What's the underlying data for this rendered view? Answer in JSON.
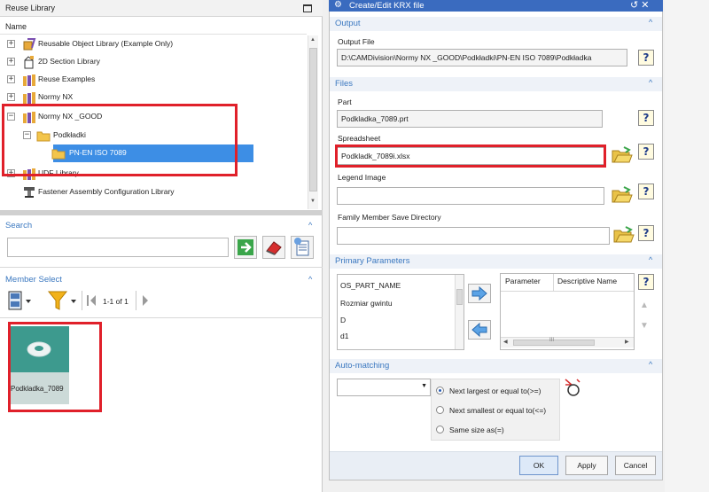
{
  "reuse_library": {
    "title": "Reuse Library",
    "column_header": "Name",
    "tree": [
      {
        "label": "Reusable Object Library (Example Only)",
        "icon": "library-cube-icon"
      },
      {
        "label": "2D Section Library",
        "icon": "section-library-icon"
      },
      {
        "label": "Reuse Examples",
        "icon": "books-icon"
      },
      {
        "label": "Normy NX",
        "icon": "books-icon"
      },
      {
        "label": "Normy NX _GOOD",
        "icon": "books-icon"
      },
      {
        "label": "Podkładki",
        "icon": "folder-icon"
      },
      {
        "label": "PN-EN ISO 7089",
        "icon": "folder-icon"
      },
      {
        "label": "UDF Library",
        "icon": "books-icon"
      },
      {
        "label": "Fastener Assembly Configuration Library",
        "icon": "fastener-config-icon"
      }
    ],
    "search": {
      "title": "Search",
      "value": "",
      "placeholder": ""
    },
    "member_select": {
      "title": "Member Select",
      "pagination": "1-1 of 1",
      "members": [
        {
          "label": "Podkladka_7089",
          "icon": "washer-icon"
        }
      ]
    }
  },
  "dialog": {
    "title": "Create/Edit KRX file",
    "title_color": "#3a6bbf",
    "accent": "#3b78c0",
    "output": {
      "title": "Output",
      "file_label": "Output File",
      "file_value": "D:\\CAMDivision\\Normy NX _GOOD\\Podkładki\\PN-EN ISO 7089\\Podkładka"
    },
    "files": {
      "title": "Files",
      "part_label": "Part",
      "part_value": "Podkladka_7089.prt",
      "spreadsheet_label": "Spreadsheet",
      "spreadsheet_value": "Podkladk_7089i.xlsx",
      "legend_label": "Legend Image",
      "legend_value": "",
      "family_dir_label": "Family Member Save Directory",
      "family_dir_value": ""
    },
    "primary_parameters": {
      "title": "Primary Parameters",
      "list": [
        "OS_PART_NAME",
        "Rozmiar gwintu",
        "D",
        "d1"
      ],
      "table_headers": [
        "Parameter",
        "Descriptive Name"
      ],
      "table_scroll_label": "III"
    },
    "auto_matching": {
      "title": "Auto-matching",
      "select_value": "",
      "options": [
        "Next largest or equal to(>=)",
        "Next smallest or equal to(<=)",
        "Same size as(=)"
      ],
      "selected_index": 0
    },
    "buttons": {
      "ok": "OK",
      "apply": "Apply",
      "cancel": "Cancel"
    },
    "window_controls": "↺ ✕",
    "help_glyph": "?",
    "collapse_glyph": "^"
  }
}
